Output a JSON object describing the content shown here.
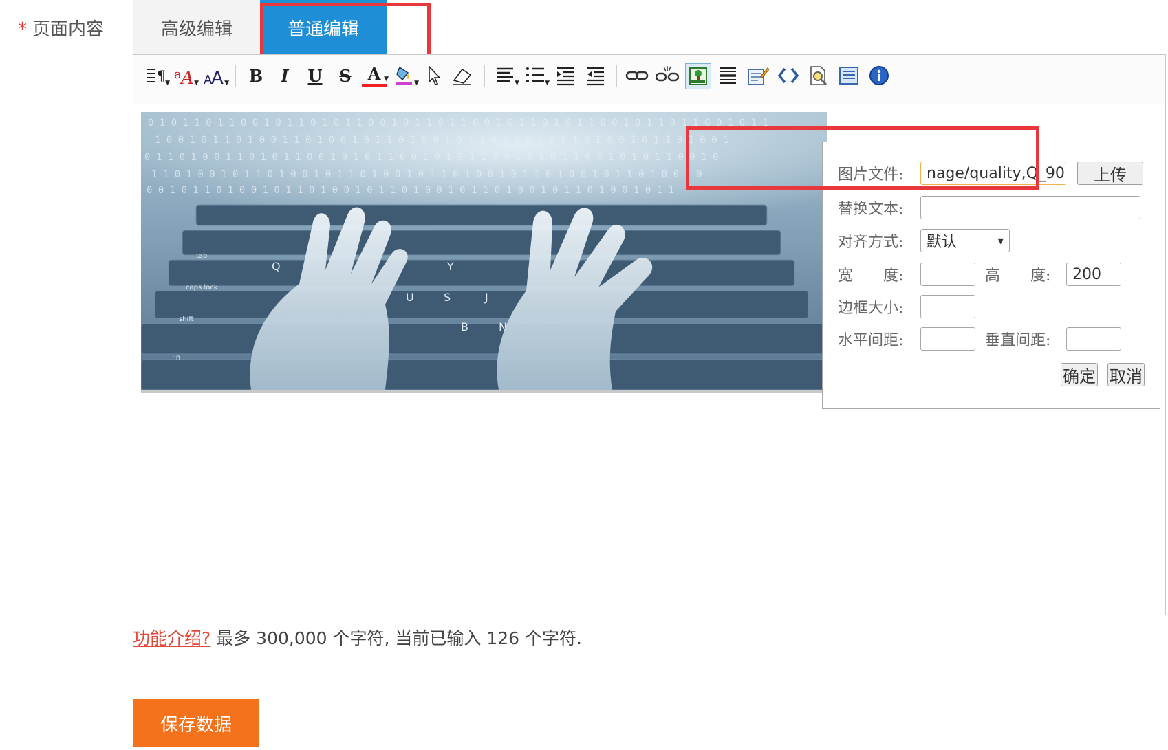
{
  "form": {
    "required_mark": "*",
    "field_label": "页面内容",
    "help_link": "功能介绍?",
    "help_text": "最多 300,000 个字符, 当前已输入 126 个字符."
  },
  "tabs": [
    {
      "label": "高级编辑",
      "active": false
    },
    {
      "label": "普通编辑",
      "active": true
    }
  ],
  "toolbar": {
    "icons": [
      "paragraph-format-icon",
      "font-family-icon",
      "font-size-icon",
      "bold-icon",
      "italic-icon",
      "underline-icon",
      "strikethrough-icon",
      "font-color-icon",
      "highlight-color-icon",
      "select-all-icon",
      "remove-format-icon",
      "align-icon",
      "ordered-list-icon",
      "indent-icon",
      "outdent-icon",
      "link-icon",
      "unlink-icon",
      "insert-image-icon",
      "horizontal-rule-icon",
      "edit-table-icon",
      "source-code-icon",
      "preview-icon",
      "fullscreen-icon",
      "about-icon"
    ],
    "glyphs": {
      "bold": "B",
      "italic": "I",
      "underline": "U",
      "strike": "S",
      "color": "A"
    }
  },
  "image_dialog": {
    "file_label": "图片文件:",
    "file_value": "nage/quality,Q_90",
    "upload_label": "上传",
    "alt_label": "替换文本:",
    "alt_value": "",
    "align_label": "对齐方式:",
    "align_value": "默认",
    "width_label": "宽　　度:",
    "width_value": "",
    "height_label": "高　　度:",
    "height_value": "200",
    "border_label": "边框大小:",
    "border_value": "",
    "hspace_label": "水平间距:",
    "hspace_value": "",
    "vspace_label": "垂直间距:",
    "vspace_value": "",
    "ok_label": "确定",
    "cancel_label": "取消"
  },
  "colors": {
    "tab_active": "#1e8fd6",
    "save_button": "#f5721c",
    "annotation": "#e8383b",
    "help_link": "#e04a3a"
  },
  "save_label": "保存数据"
}
